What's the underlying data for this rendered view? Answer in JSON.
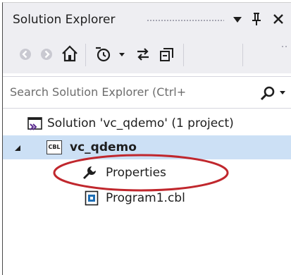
{
  "panel": {
    "title": "Solution Explorer"
  },
  "toolbar": {
    "buttons": [
      "back-icon",
      "forward-icon",
      "home-icon",
      "history-icon",
      "dropdown-icon",
      "sync-icon",
      "collapse-all-icon"
    ]
  },
  "search": {
    "placeholder": "Search Solution Explorer (Ctrl+"
  },
  "tree": {
    "solution_label": "Solution 'vc_qdemo' (1 project)",
    "project_label": "vc_qdemo",
    "project_icon_text": "CBL",
    "items": [
      {
        "label": "Properties",
        "icon": "wrench-icon"
      },
      {
        "label": "Program1.cbl",
        "icon": "cobol-file-icon"
      }
    ]
  },
  "colors": {
    "selection": "#cce0f5",
    "annotation": "#c0272d",
    "chrome": "#eeeef2"
  }
}
